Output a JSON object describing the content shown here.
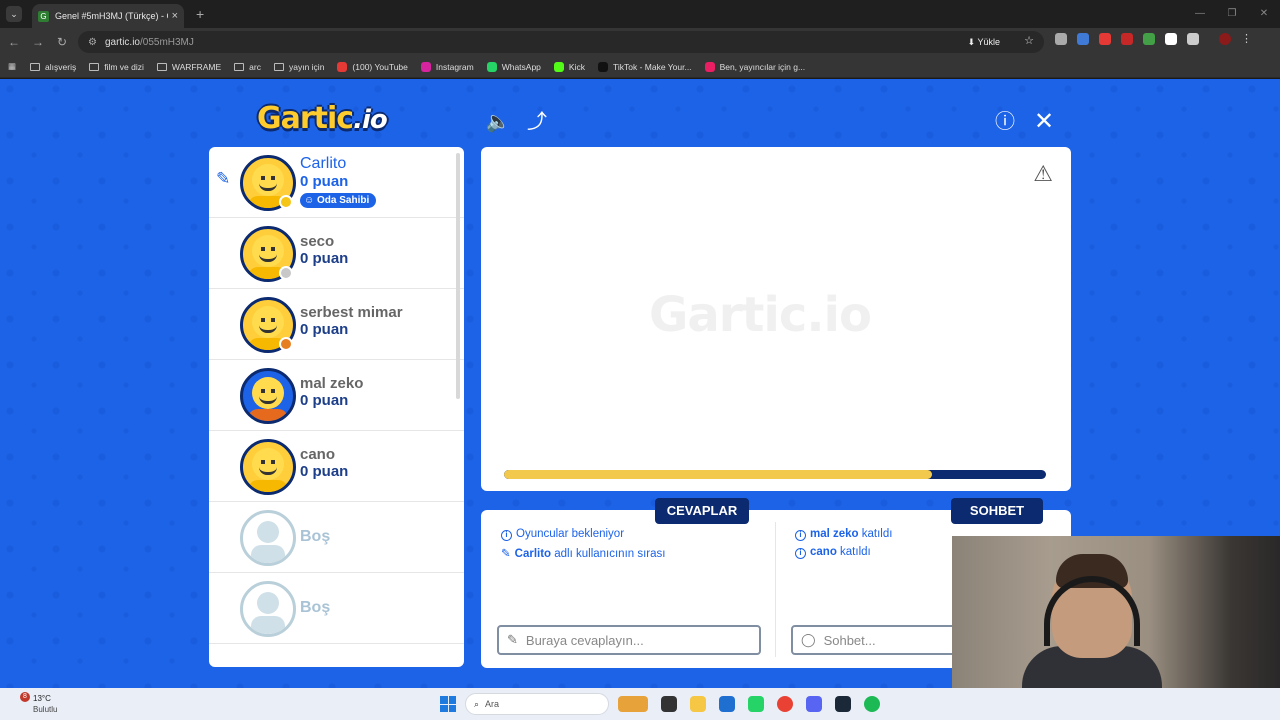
{
  "browser": {
    "tab_title": "Genel #5mH3MJ (Türkçe) - Gar",
    "url_host": "gartic.io",
    "url_path": "/055mH3MJ",
    "load_label": "Yükle"
  },
  "bookmarks": [
    {
      "label": "alışveriş",
      "kind": "folder"
    },
    {
      "label": "film ve dizi",
      "kind": "folder"
    },
    {
      "label": "WARFRAME",
      "kind": "folder"
    },
    {
      "label": "arc",
      "kind": "folder"
    },
    {
      "label": "yayın için",
      "kind": "folder"
    },
    {
      "label": "(100) YouTube",
      "kind": "youtube"
    },
    {
      "label": "Instagram",
      "kind": "instagram"
    },
    {
      "label": "WhatsApp",
      "kind": "whatsapp"
    },
    {
      "label": "Kick",
      "kind": "kick"
    },
    {
      "label": "TikTok - Make Your...",
      "kind": "tiktok"
    },
    {
      "label": "Ben, yayıncılar için g...",
      "kind": "bi"
    }
  ],
  "game": {
    "logo": "Gartic",
    "logo_suffix": ".io",
    "players": [
      {
        "name": "Carlito",
        "score": "0 puan",
        "badge": "Oda Sahibi",
        "drawing": true,
        "status_color": "#f5c518"
      },
      {
        "name": "seco",
        "score": "0 puan",
        "status_color": "#c8c8c8"
      },
      {
        "name": "serbest mimar",
        "score": "0 puan",
        "status_color": "#e67e22"
      },
      {
        "name": "mal zeko",
        "score": "0 puan",
        "status_color": null
      },
      {
        "name": "cano",
        "score": "0 puan",
        "status_color": null
      },
      {
        "name": "Boş",
        "empty": true
      },
      {
        "name": "Boş",
        "empty": true
      }
    ],
    "watermark": "Gartic.io",
    "timer_progress": 0.79,
    "answers_tab": "CEVAPLAR",
    "chat_tab": "SOHBET",
    "answers": [
      {
        "text": "Oyuncular bekleniyor"
      },
      {
        "bold": "Carlito",
        "text": " adlı kullanıcının sırası"
      }
    ],
    "chat": [
      {
        "bold": "mal zeko",
        "text": " katıldı"
      },
      {
        "bold": "cano",
        "text": " katıldı"
      }
    ],
    "answer_placeholder": "Buraya cevaplayın...",
    "chat_placeholder": "Sohbet..."
  },
  "taskbar": {
    "weather_badge": "8",
    "temp": "13°C",
    "weather": "Bulutlu",
    "search_placeholder": "Ara"
  },
  "colors": {
    "brand_blue": "#1d63e8",
    "navy": "#0b2a6f",
    "gold": "#f2c94c"
  }
}
